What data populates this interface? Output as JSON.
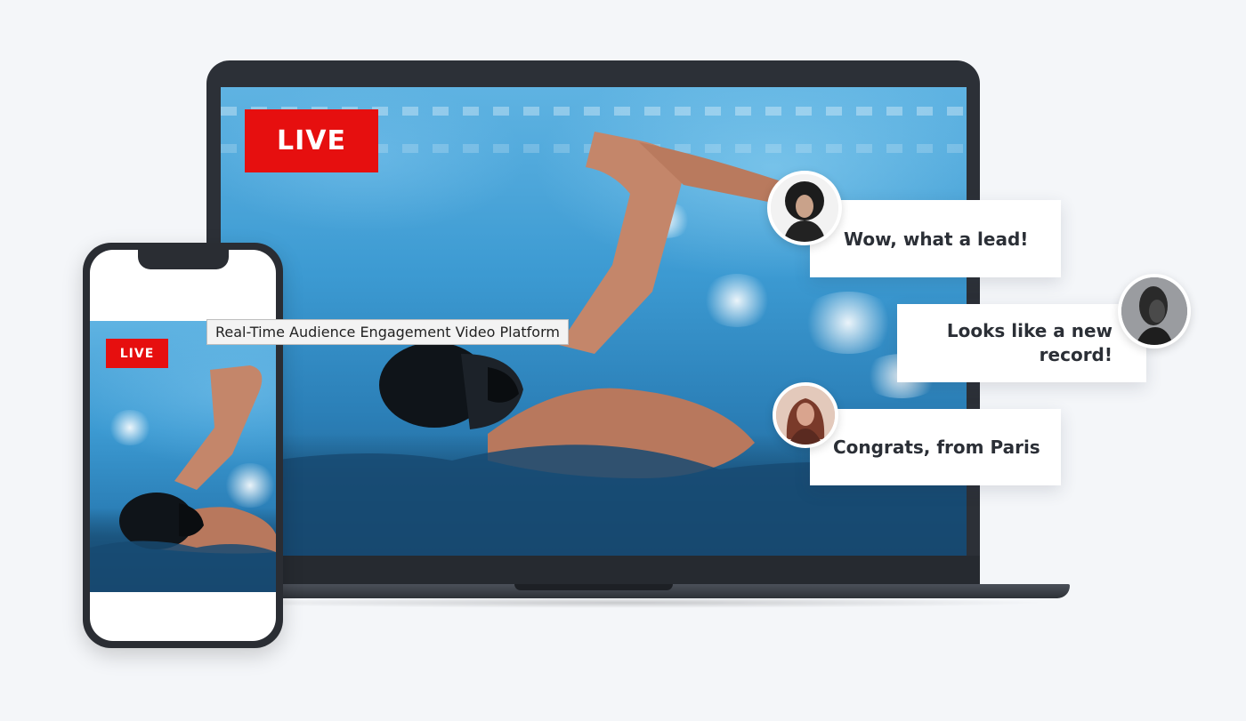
{
  "laptop": {
    "live_label": "LIVE"
  },
  "phone": {
    "live_label": "LIVE"
  },
  "tooltip": {
    "text": "Real-Time Audience Engagement Video Platform"
  },
  "chat": [
    {
      "message": "Wow, what a lead!"
    },
    {
      "message": "Looks like a new record!"
    },
    {
      "message": "Congrats, from Paris"
    }
  ],
  "colors": {
    "live_red": "#e60f0f",
    "device_dark": "#2c3037",
    "pool_blue": "#3c9ad2",
    "background": "#f4f6f9"
  }
}
